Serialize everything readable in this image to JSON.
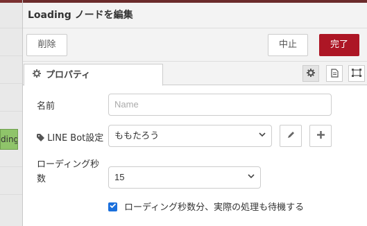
{
  "workspace": {
    "node_label": "ding"
  },
  "tray": {
    "title": "Loading ノードを編集",
    "buttons": {
      "delete": "削除",
      "cancel": "中止",
      "done": "完了"
    },
    "tabs": {
      "properties": "プロパティ"
    },
    "icons": {
      "properties_tab": "gear-icon",
      "settings": "gear-icon",
      "description": "document-icon",
      "appearance": "frame-icon"
    },
    "form": {
      "name_label": "名前",
      "name_placeholder": "Name",
      "bot_label": "LINE Bot設定",
      "bot_value": "ももたろう",
      "seconds_label_1": "ローディング秒",
      "seconds_label_2": "数",
      "seconds_value": "15",
      "wait_label": "ローディング秒数分、実際の処理も待機する",
      "wait_checked": true
    }
  },
  "colors": {
    "done_button": "#ad1625",
    "checkbox": "#1a6fdc",
    "node": "#8fc46a"
  }
}
